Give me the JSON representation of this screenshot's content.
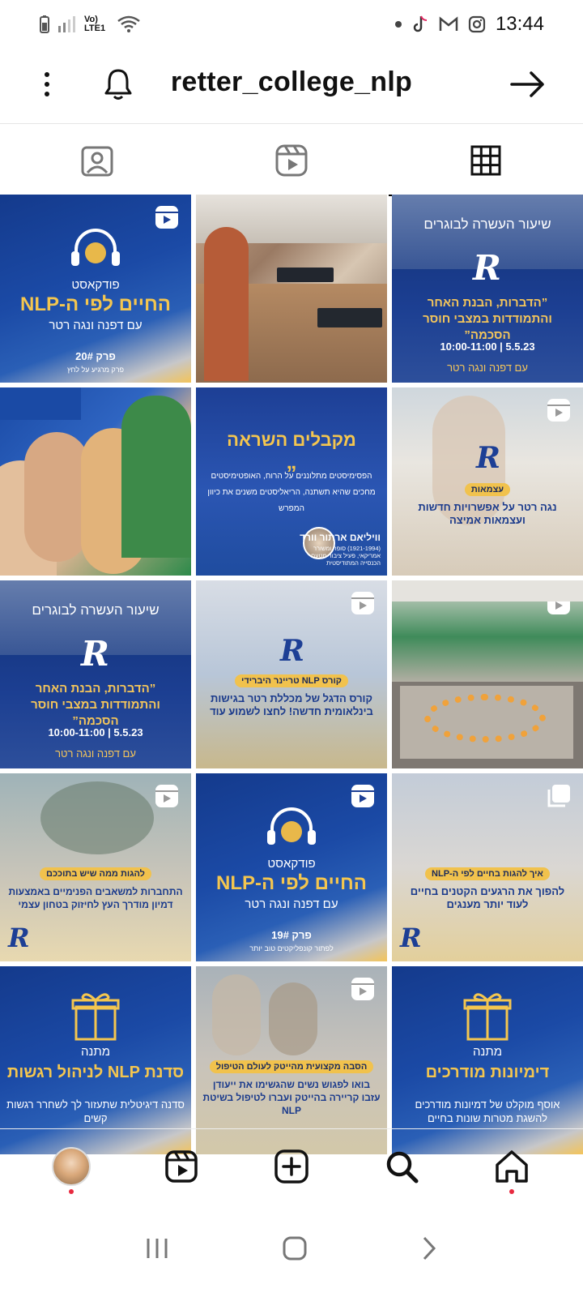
{
  "status_bar": {
    "network": "Vo) LTE1",
    "time": "13:44",
    "notification_icons": [
      "dot-icon",
      "tiktok-icon",
      "gmail-icon",
      "instagram-icon"
    ]
  },
  "header": {
    "username": "retter_college_nlp"
  },
  "tabs": [
    {
      "name": "tagged",
      "icon": "tagged-person-icon"
    },
    {
      "name": "reels",
      "icon": "reels-icon"
    },
    {
      "name": "grid",
      "icon": "grid-icon",
      "active": true
    }
  ],
  "posts": [
    {
      "top": "פודקאסט",
      "title": "החיים לפי ה-NLP",
      "sub": "עם דפנה ונגה רטר",
      "episode": "פרק 20#",
      "caption": "פרק מרגיע על לחץ",
      "badge": "reel"
    },
    {
      "badge": "none"
    },
    {
      "title": "שיעור העשרה לבוגרים",
      "quote": "”הדברות, הבנת האחר והתמודדות במצבי חוסר הסכמה”",
      "time": "10:00-11:00 | 5.5.23",
      "by": "עם דפנה ונגה רטר",
      "badge": "none"
    },
    {
      "badge": "none"
    },
    {
      "title": "מקבלים השראה",
      "body": "הפסימיסטים מתלוננים על הרוח, האופטימיסטים מחכים שהיא תשתנה, הריאליסטים משנים את כיוון המפרש",
      "author": "וויליאם ארתור וורד",
      "author_desc": "(1921-1994) סופר ומשורר אמריקאי, פעיל ציבור מטעם הכנסייה המתודיסטית",
      "badge": "none"
    },
    {
      "pill": "עצמאות",
      "body": "נגה רטר על אפשרויות חדשות ועצמאות אמיצה",
      "badge": "reel"
    },
    {
      "title": "שיעור העשרה לבוגרים",
      "quote": "”הדברות, הבנת האחר והתמודדות במצבי חוסר הסכמה”",
      "time": "10:00-11:00 | 5.5.23",
      "by": "עם דפנה ונגה רטר",
      "badge": "none"
    },
    {
      "pill": "קורס NLP טריינר היברידי",
      "body": "קורס הדגל של מכללת רטר בגישות בינלאומית חדשה! לחצו לשמוע עוד",
      "badge": "reel"
    },
    {
      "badge": "reel"
    },
    {
      "pill": "להגות ממה שיש בתוככם",
      "body": "התחברות למשאבים הפנימיים באמצעות דמיון מודרך העץ לחיזוק בטחון עצמי",
      "badge": "reel"
    },
    {
      "top": "פודקאסט",
      "title": "החיים לפי ה-NLP",
      "sub": "עם דפנה ונגה רטר",
      "episode": "פרק 19#",
      "caption": "לפתור קונפליקטים טוב יותר",
      "badge": "reel"
    },
    {
      "pill": "איך להגות בחיים לפי ה-NLP",
      "body": "להפוך את הרגעים הקטנים בחיים לעוד יותר מענגים",
      "badge": "multi"
    },
    {
      "top": "מתנה",
      "title": "סדנת NLP לניהול רגשות",
      "body": "סדנה דיגיטלית שתעזור לך לשחרר רגשות קשים",
      "badge": "none"
    },
    {
      "pill": "הסבה מקצועית מהייטק לעולם הטיפול",
      "body": "בואו לפגוש נשים שהגשימו את ייעודן עזבו קריירה בהייטק ועברו לטיפול בשיטת NLP",
      "badge": "reel"
    },
    {
      "top": "מתנה",
      "title": "דימיונות מודרכים",
      "body": "אוסף מוקלט של דמיונות מודרכים להשגת מטרות שונות בחיים",
      "badge": "none"
    }
  ],
  "bottom_nav": [
    "profile-avatar",
    "reels-icon",
    "create-icon",
    "search-icon",
    "home-icon"
  ],
  "system_nav": [
    "recents-icon",
    "home-circle-icon",
    "back-icon"
  ]
}
